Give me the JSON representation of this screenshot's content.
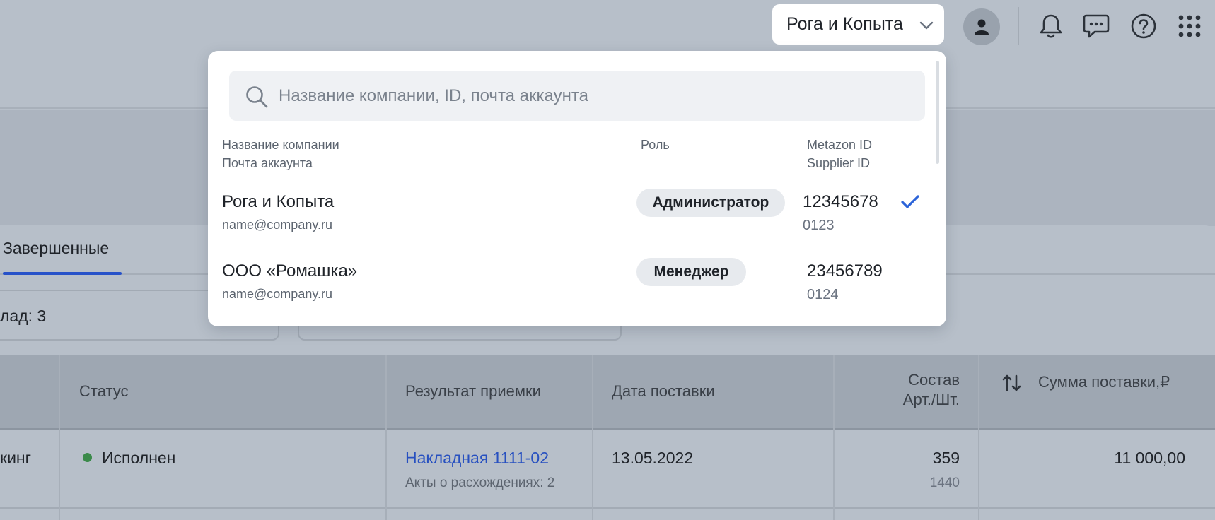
{
  "header": {
    "company_selector": "Рога и Копыта"
  },
  "icons": {
    "avatar": "user-icon",
    "notifications": "bell-icon",
    "chat": "chat-icon",
    "help": "help-icon",
    "apps": "apps-grid-icon"
  },
  "tabs": {
    "completed": "Завершенные"
  },
  "filters": {
    "warehouse_partial": "лад: 3"
  },
  "table": {
    "headers": {
      "status": "Статус",
      "acceptance_result": "Результат приемки",
      "delivery_date": "Дата поставки",
      "composition_line1": "Состав",
      "composition_line2": "Арт./Шт.",
      "delivery_sum": "Сумма поставки,₽"
    },
    "rows": [
      {
        "type_partial": "кинг",
        "status": "Исполнен",
        "invoice": "Накладная 1111-02",
        "discrepancy": "Акты о расхождениях: 2",
        "date": "13.05.2022",
        "articles": "359",
        "pieces": "1440",
        "sum": "11 000,00"
      }
    ]
  },
  "dropdown": {
    "search_placeholder": "Название компании, ID, почта аккаунта",
    "columns": {
      "company_name": "Название компании",
      "account_email": "Почта аккаунта",
      "role": "Роль",
      "metazon_id": "Metazon ID",
      "supplier_id": "Supplier ID"
    },
    "companies": [
      {
        "name": "Рога и Копыта",
        "email": "name@company.ru",
        "role": "Администратор",
        "metazon_id": "12345678",
        "supplier_id": "0123",
        "selected": true
      },
      {
        "name": "ООО «Ромашка»",
        "email": "name@company.ru",
        "role": "Менеджер",
        "metazon_id": "23456789",
        "supplier_id": "0124",
        "selected": false
      }
    ]
  },
  "colors": {
    "accent": "#2750c0",
    "status_done": "#3b8a4a",
    "check": "#2b63d9"
  }
}
